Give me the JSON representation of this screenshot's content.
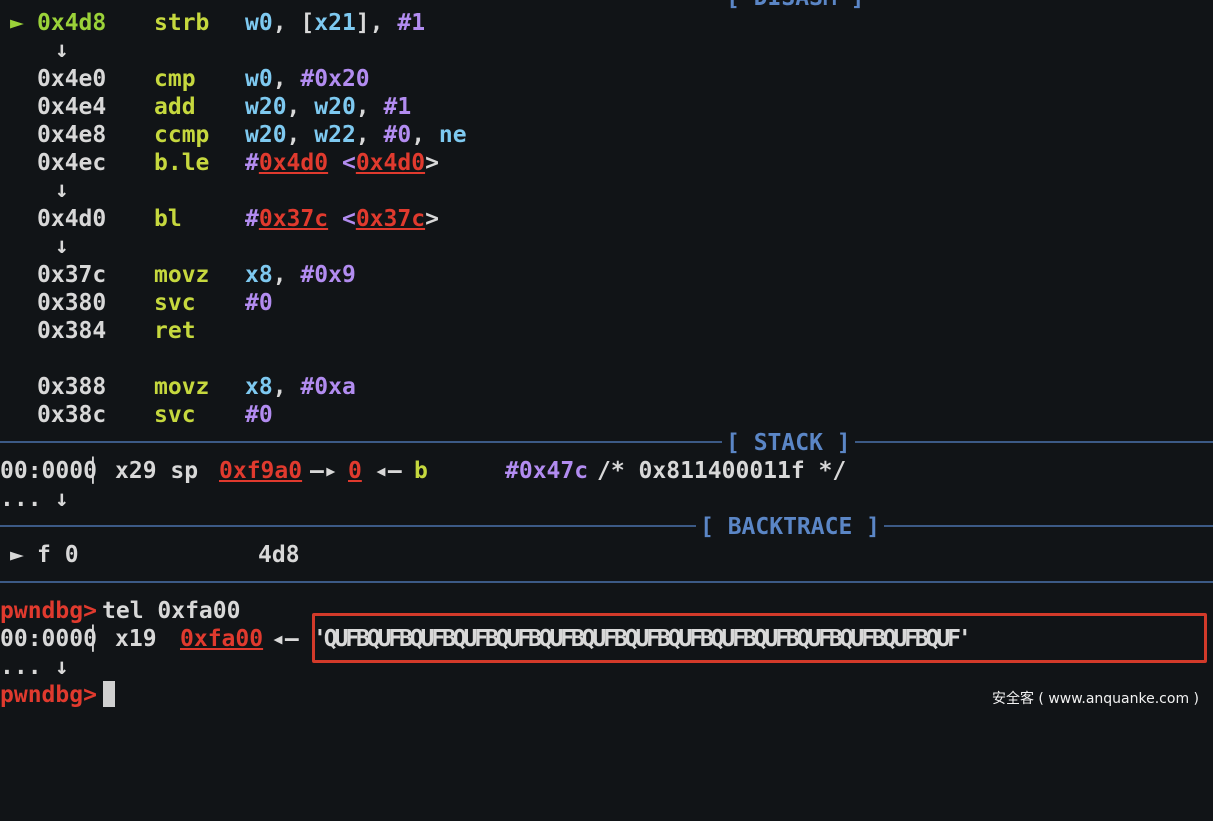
{
  "disasm": {
    "section_title": "[ DISASM ]",
    "current": {
      "marker": "►",
      "address": "0x4d8",
      "mnemonic": "strb",
      "op1": "w0",
      "op2": "x21",
      "op3": "#1"
    },
    "rows": [
      {
        "address": "0x4e0",
        "mnemonic": "cmp",
        "a": "w0",
        "b": "#0x20"
      },
      {
        "address": "0x4e4",
        "mnemonic": "add",
        "a": "w20",
        "b": "w20",
        "c": "#1"
      },
      {
        "address": "0x4e8",
        "mnemonic": "ccmp",
        "a": "w20",
        "b": "w22",
        "c": "#0",
        "d": "ne"
      },
      {
        "address": "0x4ec",
        "mnemonic": "b.le",
        "target": "0x4d0"
      },
      {
        "address": "0x4d0",
        "mnemonic": "bl",
        "target": "0x37c"
      },
      {
        "address": "0x37c",
        "mnemonic": "movz",
        "a": "x8",
        "b": "#0x9"
      },
      {
        "address": "0x380",
        "mnemonic": "svc",
        "a": "#0"
      },
      {
        "address": "0x384",
        "mnemonic": "ret"
      },
      {
        "address": "0x388",
        "mnemonic": "movz",
        "a": "x8",
        "b": "#0xa"
      },
      {
        "address": "0x38c",
        "mnemonic": "svc",
        "a": "#0"
      }
    ],
    "flow_arrow": "↓"
  },
  "stack": {
    "section_title": "[ STACK ]",
    "offset": "00:0000",
    "regs": "x29 sp",
    "addr": "0xf9a0",
    "value": "0",
    "symbol": "b",
    "imm": "#0x47c",
    "comment": "/* 0x811400011f */",
    "ellipsis": "...",
    "arrow": "↓"
  },
  "backtrace": {
    "section_title": "[ BACKTRACE ]",
    "marker": "►",
    "frame": "f 0",
    "addr": "4d8"
  },
  "console": {
    "prompt": "pwndbg>",
    "command": "tel 0xfa00",
    "offset": "00:0000",
    "reg": "x19",
    "addr": "0xfa00",
    "string": "'QUFBQUFBQUFBQUFBQUFBQUFBQUFBQUFBQUFBQUFBQUFBQUFBQUFBQUFBQUF'",
    "ellipsis": "..."
  },
  "watermark": "安全客 ( www.anquanke.com )"
}
